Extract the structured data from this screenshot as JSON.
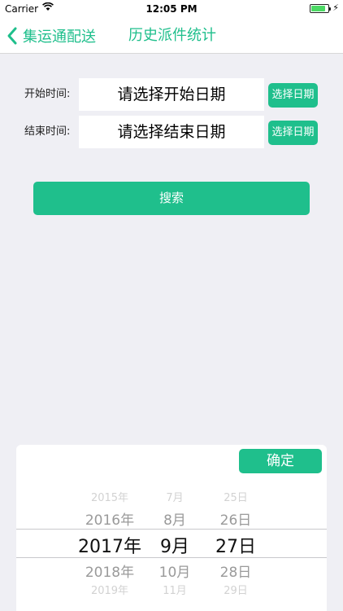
{
  "status_bar": {
    "carrier": "Carrier",
    "time": "12:05 PM",
    "battery_level": 0.85
  },
  "nav": {
    "back_label": "集运通配送",
    "title": "历史派件统计"
  },
  "form": {
    "start_label": "开始时间:",
    "start_placeholder": "请选择开始日期",
    "end_label": "结束时间:",
    "end_placeholder": "请选择结束日期",
    "pick_date_label": "选择日期",
    "search_label": "搜索"
  },
  "picker": {
    "confirm_label": "确定",
    "years": [
      "2015年",
      "2016年",
      "2017年",
      "2018年",
      "2019年"
    ],
    "months": [
      "7月",
      "8月",
      "9月",
      "10月",
      "11月"
    ],
    "days": [
      "25日",
      "26日",
      "27日",
      "28日",
      "29日"
    ],
    "selected": {
      "year": "2017年",
      "month": "9月",
      "day": "27日"
    }
  },
  "colors": {
    "accent": "#1fbf8c",
    "background": "#efeff4",
    "battery": "#4cd964"
  }
}
